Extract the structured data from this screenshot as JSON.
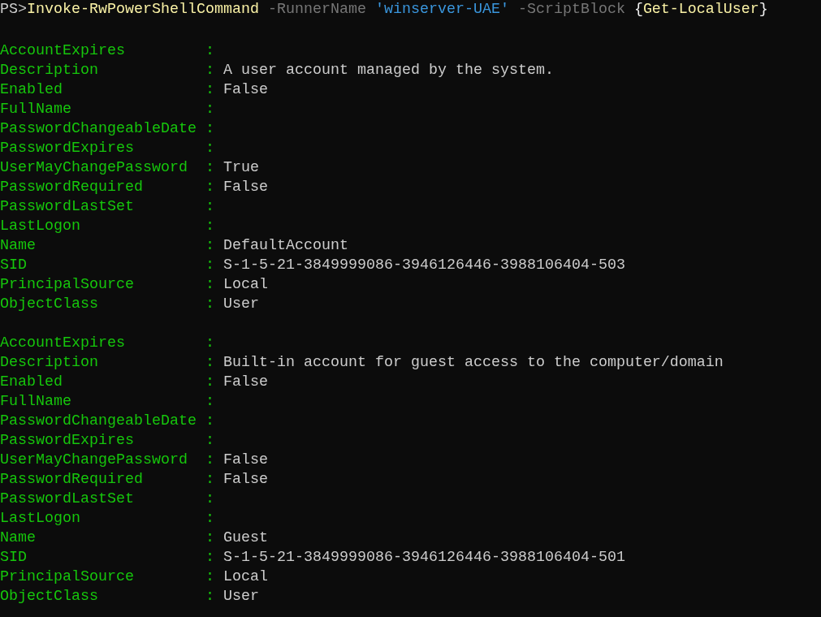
{
  "command": [
    {
      "tokens": [
        {
          "kind": "prompt",
          "text": "PS>"
        },
        {
          "kind": "cmdlet",
          "text": "Invoke-RwPowerShellCommand"
        }
      ]
    },
    {
      "tokens": [
        {
          "kind": "parameter",
          "text": "-RunnerName"
        }
      ]
    },
    {
      "tokens": [
        {
          "kind": "string",
          "text": "'winserver-UAE'"
        }
      ]
    },
    {
      "tokens": [
        {
          "kind": "parameter",
          "text": "-ScriptBlock"
        }
      ]
    },
    {
      "tokens": [
        {
          "kind": "brace",
          "text": "{"
        },
        {
          "kind": "cmdlet",
          "text": "Get-LocalUser"
        },
        {
          "kind": "brace",
          "text": "}"
        }
      ]
    }
  ],
  "records": [
    {
      "fields": [
        {
          "key": "AccountExpires",
          "sep": ":"
        },
        {
          "key": "Description",
          "sep": ":",
          "value": "A user account managed by the system."
        },
        {
          "key": "Enabled",
          "sep": ":",
          "value": "False"
        },
        {
          "key": "FullName",
          "sep": ":"
        },
        {
          "key": "PasswordChangeableDate",
          "sep": ":"
        },
        {
          "key": "PasswordExpires",
          "sep": ":"
        },
        {
          "key": "UserMayChangePassword",
          "sep": ":",
          "value": "True"
        },
        {
          "key": "PasswordRequired",
          "sep": ":",
          "value": "False"
        },
        {
          "key": "PasswordLastSet",
          "sep": ":"
        },
        {
          "key": "LastLogon",
          "sep": ":"
        },
        {
          "key": "Name",
          "sep": ":",
          "value": "DefaultAccount"
        },
        {
          "key": "SID",
          "sep": ":",
          "value": "S-1-5-21-3849999086-3946126446-3988106404-503"
        },
        {
          "key": "PrincipalSource",
          "sep": ":",
          "value": "Local"
        },
        {
          "key": "ObjectClass",
          "sep": ":",
          "value": "User"
        }
      ]
    },
    {
      "fields": [
        {
          "key": "AccountExpires",
          "sep": ":"
        },
        {
          "key": "Description",
          "sep": ":",
          "value": "Built-in account for guest access to the computer/domain"
        },
        {
          "key": "Enabled",
          "sep": ":",
          "value": "False"
        },
        {
          "key": "FullName",
          "sep": ":"
        },
        {
          "key": "PasswordChangeableDate",
          "sep": ":"
        },
        {
          "key": "PasswordExpires",
          "sep": ":"
        },
        {
          "key": "UserMayChangePassword",
          "sep": ":",
          "value": "False"
        },
        {
          "key": "PasswordRequired",
          "sep": ":",
          "value": "False"
        },
        {
          "key": "PasswordLastSet",
          "sep": ":"
        },
        {
          "key": "LastLogon",
          "sep": ":"
        },
        {
          "key": "Name",
          "sep": ":",
          "value": "Guest"
        },
        {
          "key": "SID",
          "sep": ":",
          "value": "S-1-5-21-3849999086-3946126446-3988106404-501"
        },
        {
          "key": "PrincipalSource",
          "sep": ":",
          "value": "Local"
        },
        {
          "key": "ObjectClass",
          "sep": ":",
          "value": "User"
        }
      ]
    }
  ]
}
